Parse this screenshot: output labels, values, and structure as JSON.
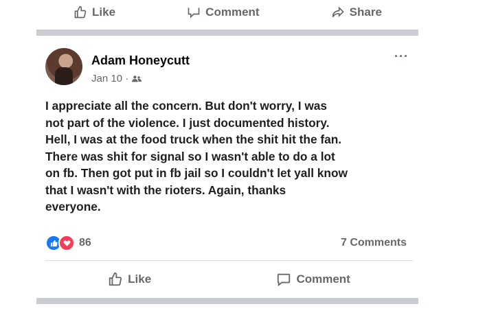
{
  "previous_post": {
    "actions": {
      "like_label": "Like",
      "comment_label": "Comment",
      "share_label": "Share"
    }
  },
  "post": {
    "author": "Adam Honeycutt",
    "date": "Jan 10 ·",
    "audience_icon": "friends-icon",
    "more_label": "···",
    "text": "I appreciate all the concern. But don't worry, I was\nnot part of the violence. I just documented history.\nHell, I was at the food truck when the shit hit the fan.\nThere was shit for signal so I wasn't able to do a lot\non fb. Then got put in fb jail so I couldn't let yall know\nthat I wasn't with the rioters. Again, thanks\neveryone.",
    "reactions": {
      "types": [
        "like",
        "love"
      ],
      "count": "86"
    },
    "comments_count": "7 Comments",
    "actions": {
      "like_label": "Like",
      "comment_label": "Comment"
    }
  },
  "colors": {
    "secondary_text": "#65676b",
    "divider": "#c9ccd1",
    "like_blue": "#1877f2",
    "love_red": "#f33e58"
  }
}
